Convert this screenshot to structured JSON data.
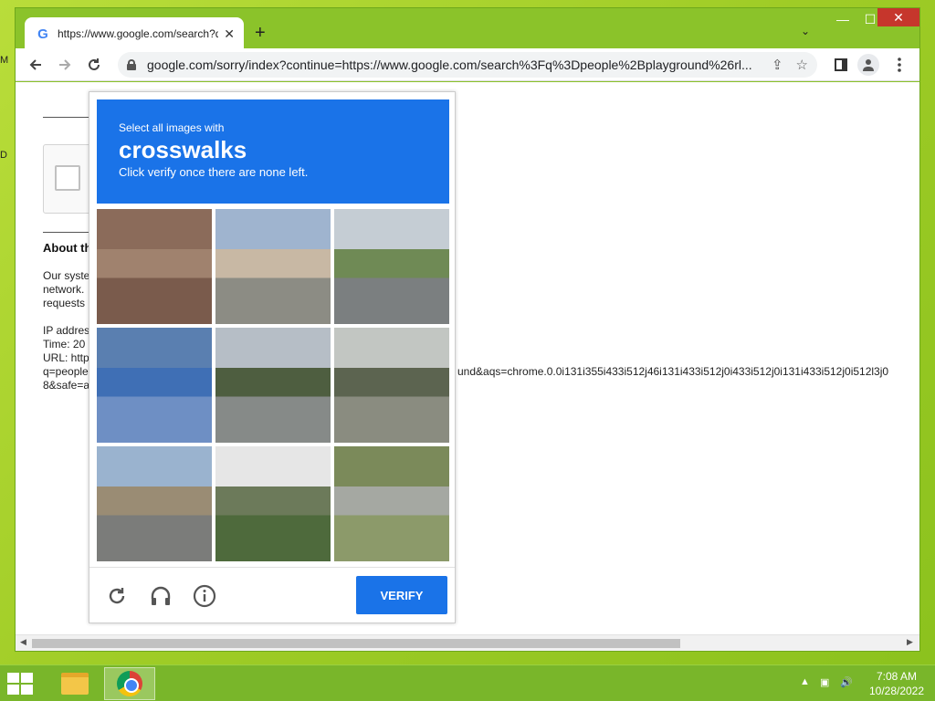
{
  "desktop": {
    "labels": [
      "M",
      "D"
    ]
  },
  "tab": {
    "title": "https://www.google.com/search?q",
    "close": "✕",
    "new_tab": "+"
  },
  "window_controls": {
    "minimize": "—",
    "maximize": "☐",
    "close": "✕",
    "tab_list": "⌄"
  },
  "toolbar": {
    "url": "google.com/sorry/index?continue=https://www.google.com/search%3Fq%3Dpeople%2Bplayground%26rl...",
    "icons": [
      "back-arrow-icon",
      "forward-arrow-icon",
      "reload-icon",
      "lock-icon",
      "share-icon",
      "bookmark-star-icon",
      "side-panel-icon",
      "profile-icon",
      "menu-icon"
    ]
  },
  "page": {
    "about_title": "About th",
    "para1": [
      "Our syste",
      "network.",
      "requests"
    ],
    "para2": [
      "IP addres",
      "Time: 20",
      "URL: http"
    ],
    "url_line_left": "q=people",
    "url_line_right": "und&aqs=chrome.0.0i131i355i433i512j46i131i433i512j0i433i512j0i131i433i512j0i512l3j0",
    "url_line_last": "8&safe=a"
  },
  "captcha": {
    "instruction_small": "Select all images with",
    "target": "crosswalks",
    "instruction_sub": "Click verify once there are none left.",
    "verify_label": "VERIFY",
    "footer_icons": [
      "reload-challenge-icon",
      "audio-challenge-icon",
      "info-icon"
    ],
    "tiles": [
      {
        "id": 1,
        "scene": "brownstone-buildings",
        "colors": [
          "#8b6b5a",
          "#a0826e",
          "#7a5b4c"
        ]
      },
      {
        "id": 2,
        "scene": "building-with-palms",
        "colors": [
          "#9fb4cf",
          "#c8b8a4",
          "#8c8c84"
        ]
      },
      {
        "id": 3,
        "scene": "empty-road",
        "colors": [
          "#c5cdd4",
          "#6f8a55",
          "#7b7f80"
        ]
      },
      {
        "id": 4,
        "scene": "intersection-crosswalk",
        "colors": [
          "#5a7fb0",
          "#3f6fb5",
          "#6e8fc4"
        ]
      },
      {
        "id": 5,
        "scene": "highway-trees",
        "colors": [
          "#b6bec6",
          "#4e5e40",
          "#868a88"
        ]
      },
      {
        "id": 6,
        "scene": "bus-parking-lot",
        "colors": [
          "#c2c6c2",
          "#5c6450",
          "#8a8c80"
        ]
      },
      {
        "id": 7,
        "scene": "wide-street-traffic",
        "colors": [
          "#9ab3cf",
          "#9a8c74",
          "#7b7c7a"
        ]
      },
      {
        "id": 8,
        "scene": "white-van-bushes",
        "colors": [
          "#e6e6e6",
          "#6c7a5a",
          "#4e6a3c"
        ]
      },
      {
        "id": 9,
        "scene": "guardrail-grass",
        "colors": [
          "#7b8a5a",
          "#a5a8a2",
          "#8c9a6a"
        ]
      }
    ],
    "header_color": "#1a73e8"
  },
  "taskbar": {
    "apps": [
      "file-explorer",
      "google-chrome"
    ],
    "tray": {
      "chevron": "▲",
      "network": "▣",
      "volume": "🔊"
    },
    "clock": {
      "time": "7:08 AM",
      "date": "10/28/2022"
    }
  }
}
